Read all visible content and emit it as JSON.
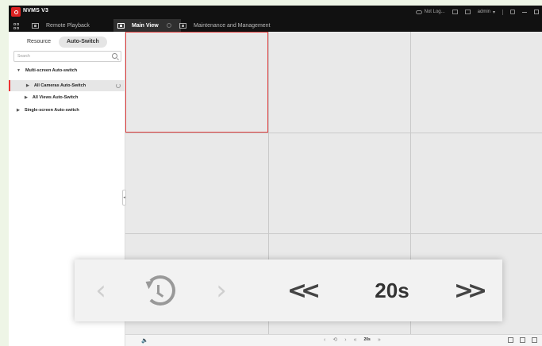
{
  "app": {
    "title": "NVMS V3",
    "tabs": [
      {
        "label": "Remote Playback",
        "active": false
      },
      {
        "label": "Main View",
        "active": true
      },
      {
        "label": "Maintenance and Management",
        "active": false
      }
    ],
    "cloud_status": "Not Log...",
    "user": "admin"
  },
  "left_panel": {
    "segments": [
      "Resource",
      "Auto-Switch"
    ],
    "active_segment": "Auto-Switch",
    "search_placeholder": "Search",
    "tree": {
      "multi": "Multi-screen Auto-switch",
      "all_cameras": "All Cameras Auto-Switch",
      "all_views": "All Views Auto-Switch",
      "single": "Single-screen Auto-switch"
    }
  },
  "bottom_bar": {
    "interval": "20s"
  },
  "zoom_overlay": {
    "interval": "20s"
  },
  "colors": {
    "accent": "#e04040",
    "topbar": "#111111",
    "panel": "#ffffff",
    "grid_bg": "#e9e9e9"
  },
  "icons": [
    "grid-icon",
    "playback-icon",
    "mainview-icon",
    "maintenance-icon",
    "cloud-icon",
    "list-icon",
    "screen-icon",
    "lock-icon",
    "minimize-icon",
    "maximize-icon",
    "search-icon",
    "refresh-icon",
    "volume-icon",
    "previous-icon",
    "loop-icon",
    "next-icon",
    "rewind-icon",
    "forward-icon"
  ]
}
